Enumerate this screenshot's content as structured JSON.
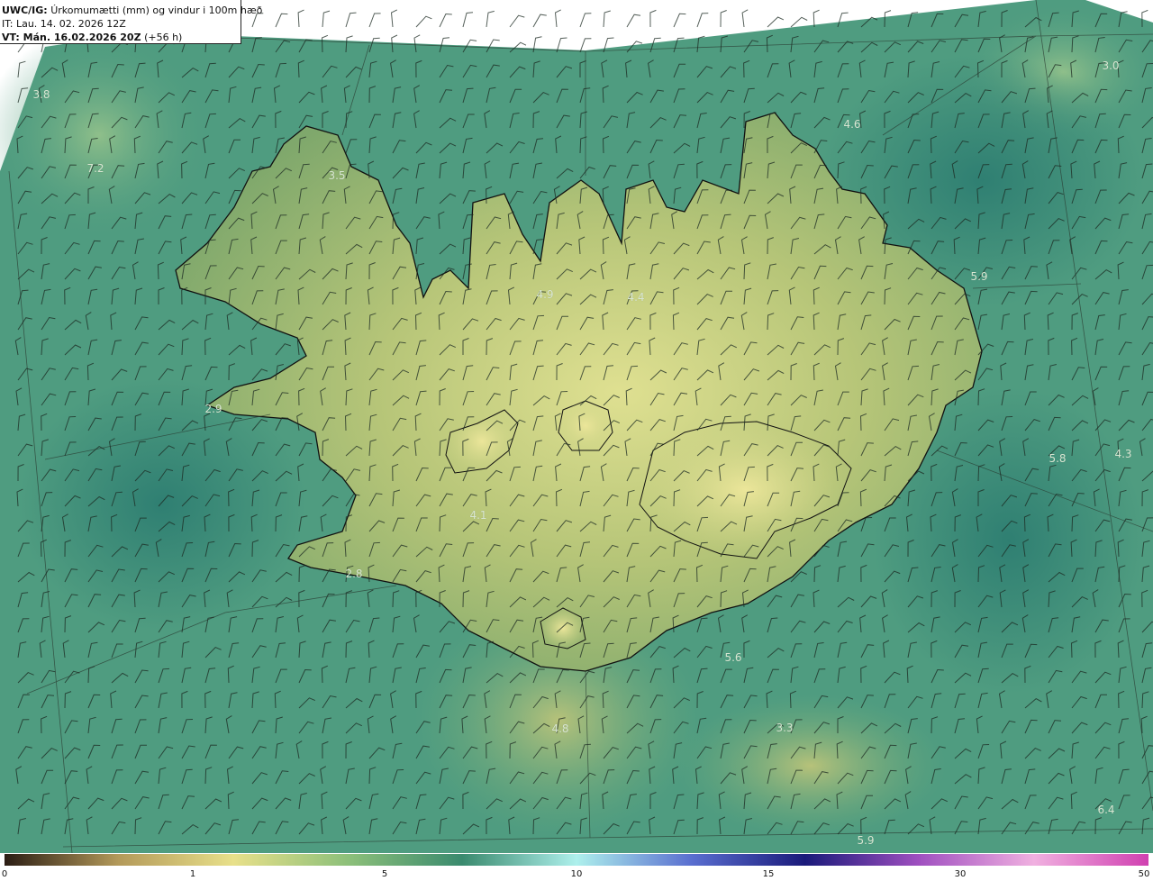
{
  "header": {
    "model": "UWC/IG:",
    "title": "Úrkomumætti (mm) og vindur i 100m hæð",
    "issue_time": "IT: Lau. 14. 02. 2026 12Z",
    "valid_label": "VT: Mán. 16.02.2026 20Z",
    "valid_offset": "(+56 h)"
  },
  "value_labels": [
    {
      "text": "3.8"
    },
    {
      "text": "7.2"
    },
    {
      "text": "3.5"
    },
    {
      "text": "3.0"
    },
    {
      "text": "4.6"
    },
    {
      "text": "5.9"
    },
    {
      "text": "4.9"
    },
    {
      "text": "4.4"
    },
    {
      "text": "2.9"
    },
    {
      "text": "5.8"
    },
    {
      "text": "4.3"
    },
    {
      "text": "4.1"
    },
    {
      "text": "2.8"
    },
    {
      "text": "5.6"
    },
    {
      "text": "4.8"
    },
    {
      "text": "3.3"
    },
    {
      "text": "6.4"
    },
    {
      "text": "5.9"
    }
  ],
  "colorbar": {
    "ticks": [
      "0",
      "1",
      "5",
      "10",
      "15",
      "30",
      "50"
    ],
    "colors": [
      "#2b1d14",
      "#b49a5a",
      "#e8e08a",
      "#8dc07a",
      "#3a8a6e",
      "#aef0ec",
      "#5a6fd0",
      "#1a1a7a",
      "#a050c0",
      "#f0b0e0",
      "#d040b0"
    ]
  },
  "colors": {
    "sea_base": "#4a9a7e",
    "land_base": "#b9c77a",
    "coast": "#111111"
  }
}
